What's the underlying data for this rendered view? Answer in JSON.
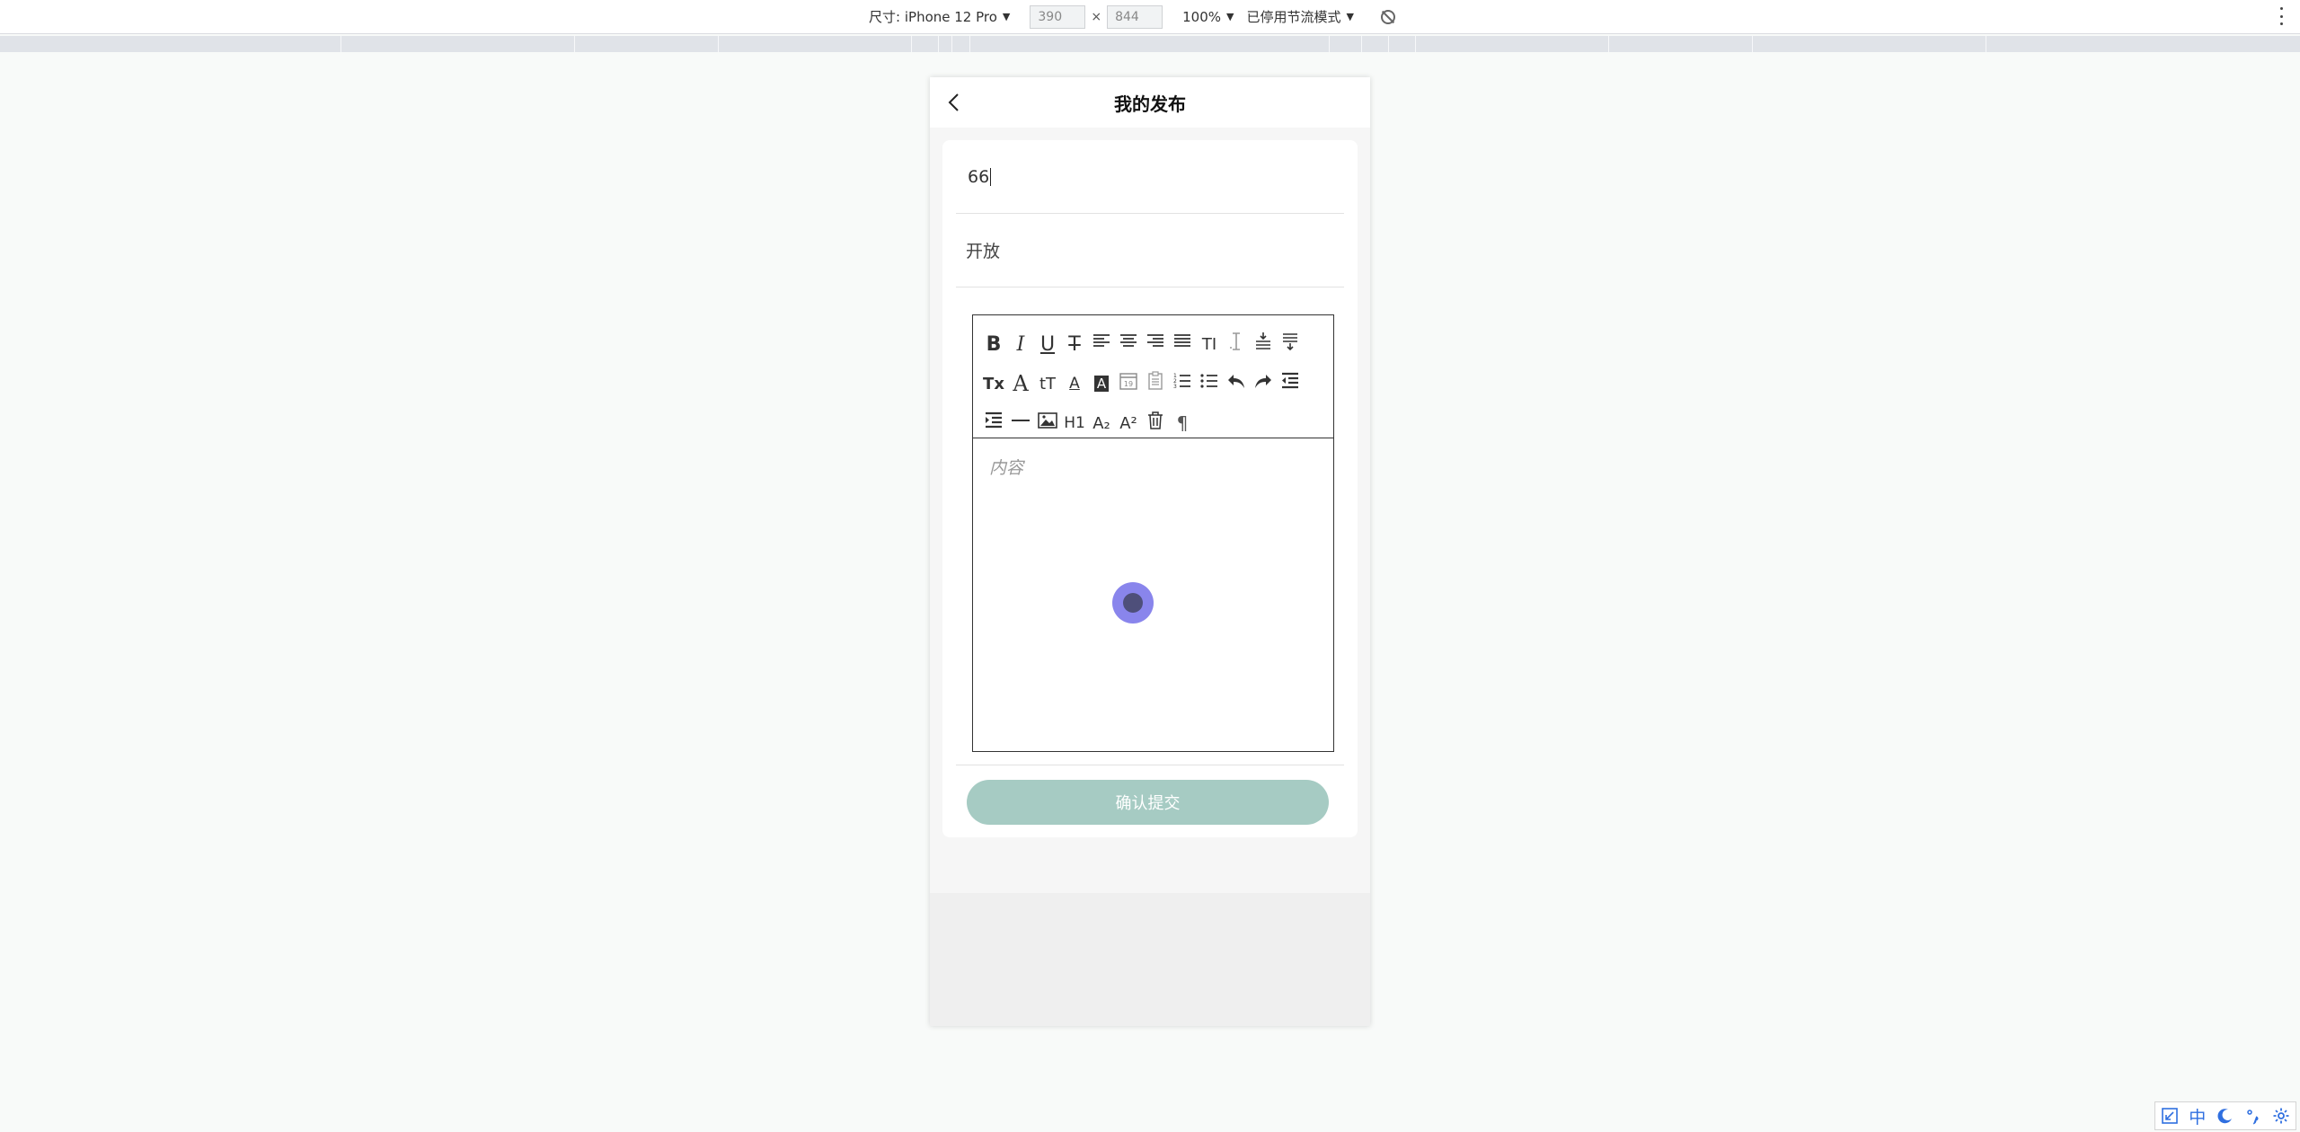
{
  "devtools": {
    "device_label": "尺寸: iPhone 12 Pro",
    "width_value": "390",
    "times": "×",
    "height_value": "844",
    "zoom_label": "100%",
    "throttle_label": "已停用节流模式",
    "caret": "▼"
  },
  "page": {
    "title": "我的发布",
    "title_input_value": "66",
    "visibility_value": "开放",
    "editor_placeholder": "内容",
    "submit_label": "确认提交"
  },
  "editor_toolbar": [
    {
      "name": "bold-button",
      "glyph": "B"
    },
    {
      "name": "italic-button",
      "glyph": "I"
    },
    {
      "name": "underline-button",
      "glyph": "U"
    },
    {
      "name": "strikethrough-button",
      "glyph": "T"
    },
    {
      "name": "align-left-button",
      "icon": "align-left-icon"
    },
    {
      "name": "align-center-button",
      "icon": "align-center-icon"
    },
    {
      "name": "align-right-button",
      "icon": "align-right-icon"
    },
    {
      "name": "align-justify-button",
      "icon": "align-justify-icon"
    },
    {
      "name": "font-size-button",
      "glyph": "TI"
    },
    {
      "name": "line-height-button",
      "icon": "text-cursor-icon"
    },
    {
      "name": "margin-top-button",
      "icon": "space-before-icon"
    },
    {
      "name": "margin-bottom-button",
      "icon": "space-after-icon"
    },
    {
      "name": "clear-format-button",
      "glyph": "Tx"
    },
    {
      "name": "font-family-button",
      "glyph": "A"
    },
    {
      "name": "text-size-button",
      "glyph": "tT"
    },
    {
      "name": "font-color-button",
      "glyph": "A"
    },
    {
      "name": "background-color-button",
      "glyph": "A"
    },
    {
      "name": "insert-date-button",
      "icon": "calendar-icon"
    },
    {
      "name": "checklist-button",
      "icon": "clipboard-icon"
    },
    {
      "name": "ordered-list-button",
      "icon": "ordered-list-icon"
    },
    {
      "name": "bullet-list-button",
      "icon": "bullet-list-icon"
    },
    {
      "name": "undo-button",
      "icon": "undo-icon"
    },
    {
      "name": "redo-button",
      "icon": "redo-icon"
    },
    {
      "name": "outdent-button",
      "icon": "outdent-icon"
    },
    {
      "name": "indent-button",
      "icon": "indent-icon"
    },
    {
      "name": "divider-button",
      "icon": "horizontal-rule-icon"
    },
    {
      "name": "insert-image-button",
      "icon": "image-icon"
    },
    {
      "name": "heading-button",
      "glyph": "H1"
    },
    {
      "name": "subscript-button",
      "glyph": "A₂"
    },
    {
      "name": "superscript-button",
      "glyph": "A²"
    },
    {
      "name": "delete-button",
      "icon": "trash-icon"
    },
    {
      "name": "paragraph-direction-button",
      "glyph": "¶"
    }
  ],
  "ime": {
    "lang": "中"
  },
  "colors": {
    "submit_bg": "#a6cbc3",
    "touch_dot": "#6a63e6",
    "ime_blue": "#2f6fe0"
  }
}
